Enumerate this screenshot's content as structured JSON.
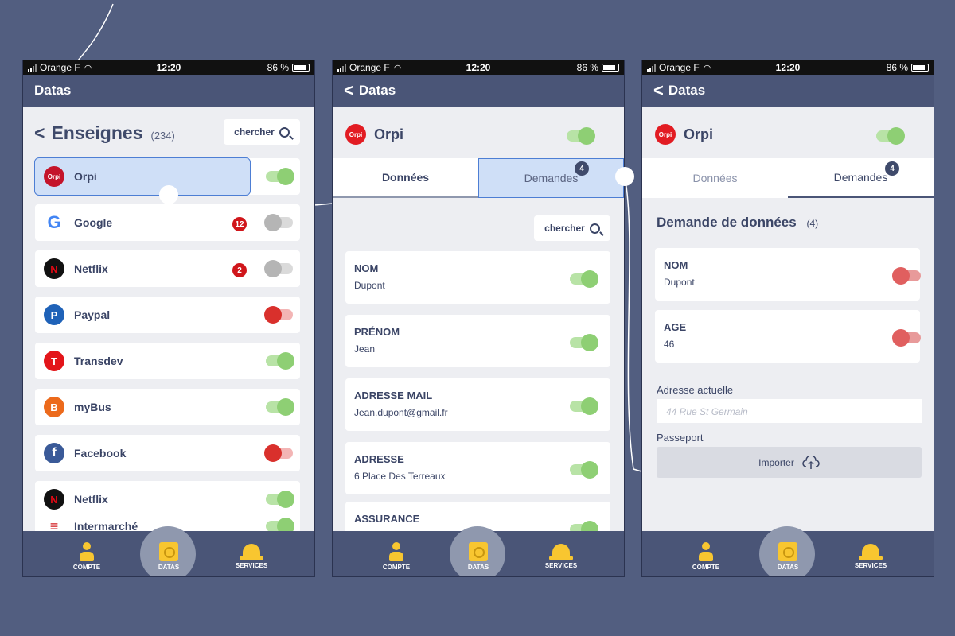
{
  "status": {
    "carrier": "Orange F",
    "time": "12:20",
    "battery": "86 %"
  },
  "tabbar": {
    "compte": "COMPTE",
    "datas": "DATAS",
    "services": "SERVICES"
  },
  "screen1": {
    "nav_title": "Datas",
    "heading": "Enseignes",
    "count": "(234)",
    "search_label": "chercher",
    "brands": [
      {
        "name": "Orpi",
        "toggle": "on",
        "logo_color": "#c4142b",
        "logo_text": "Orpi"
      },
      {
        "name": "Google",
        "toggle": "off",
        "badge": "12",
        "logo_color": "#ffffff",
        "logo_text": "G"
      },
      {
        "name": "Netflix",
        "toggle": "off",
        "badge": "2",
        "logo_color": "#111111",
        "logo_text": "N"
      },
      {
        "name": "Paypal",
        "toggle": "red",
        "logo_color": "#1f62b8",
        "logo_text": "P"
      },
      {
        "name": "Transdev",
        "toggle": "on",
        "logo_color": "#e3151a",
        "logo_text": "T"
      },
      {
        "name": "myBus",
        "toggle": "on",
        "logo_color": "#ec6a1c",
        "logo_text": "B"
      },
      {
        "name": "Facebook",
        "toggle": "red",
        "logo_color": "#3a5a98",
        "logo_text": "f"
      },
      {
        "name": "Netflix",
        "toggle": "on",
        "logo_color": "#111111",
        "logo_text": "N"
      },
      {
        "name": "Intermarché",
        "toggle": "on",
        "logo_color": "#ffffff",
        "logo_text": "≡"
      }
    ]
  },
  "screen2": {
    "nav_title": "Datas",
    "brand": "Orpi",
    "tab_data": "Données",
    "tab_requests": "Demandes",
    "requests_badge": "4",
    "search_label": "chercher",
    "fields": [
      {
        "label": "NOM",
        "value": "Dupont"
      },
      {
        "label": "PRÉNOM",
        "value": "Jean"
      },
      {
        "label": "ADRESSE MAIL",
        "value": "Jean.dupont@gmail.fr"
      },
      {
        "label": "ADRESSE",
        "value": "6 Place Des Terreaux"
      },
      {
        "label": "ASSURANCE",
        "value": ""
      }
    ]
  },
  "screen3": {
    "nav_title": "Datas",
    "brand": "Orpi",
    "tab_data": "Données",
    "tab_requests": "Demandes",
    "requests_badge": "4",
    "section_title": "Demande de données",
    "section_count": "(4)",
    "fields": [
      {
        "label": "NOM",
        "value": "Dupont"
      },
      {
        "label": "AGE",
        "value": "46"
      }
    ],
    "address_label": "Adresse actuelle",
    "address_placeholder": "44 Rue St Germain",
    "passport_label": "Passeport",
    "import_label": "Importer"
  },
  "colors": {
    "background": "#525e80",
    "navbar": "#4a5577",
    "accent_green": "#8ecf74",
    "accent_red": "#d9302c",
    "accent_yellow": "#f8c630"
  }
}
